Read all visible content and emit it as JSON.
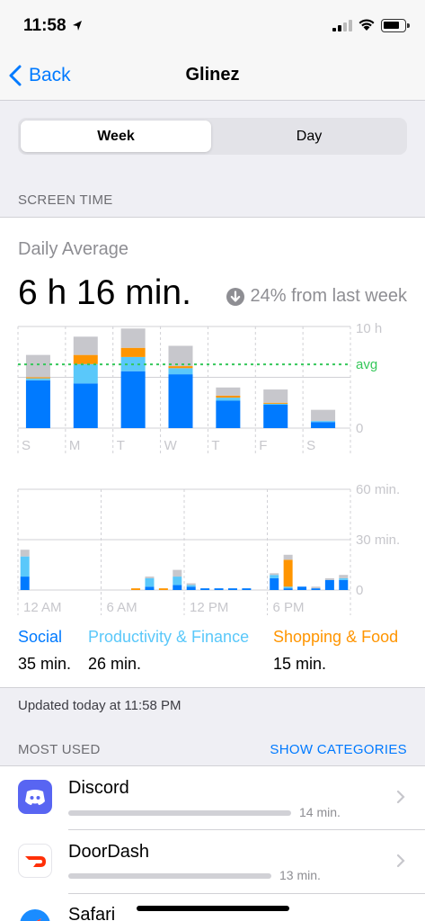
{
  "status": {
    "time": "11:58"
  },
  "nav": {
    "back_label": "Back",
    "title": "Glinez"
  },
  "segments": {
    "week": "Week",
    "day": "Day"
  },
  "section_screen_time": "SCREEN TIME",
  "summary": {
    "label": "Daily Average",
    "value": "6 h 16 min.",
    "delta": "24% from last week"
  },
  "colors": {
    "social": "#007aff",
    "productivity": "#5ac8fa",
    "shopping": "#ff9500",
    "other": "#c7c7cc",
    "average": "#34c759"
  },
  "chart_data": [
    {
      "type": "bar",
      "categories": [
        "S",
        "M",
        "T",
        "W",
        "T",
        "F",
        "S"
      ],
      "y_ticks": [
        "10 h",
        "avg",
        "0"
      ],
      "ylim": [
        0,
        10
      ],
      "average": 6.27,
      "series": [
        {
          "name": "Social",
          "values": [
            4.7,
            4.4,
            5.6,
            5.3,
            2.7,
            2.3,
            0.6
          ]
        },
        {
          "name": "Productivity & Finance",
          "values": [
            0.2,
            1.9,
            1.4,
            0.6,
            0.3,
            0.1,
            0.1
          ]
        },
        {
          "name": "Shopping & Food",
          "values": [
            0.1,
            0.9,
            0.9,
            0.2,
            0.2,
            0.1,
            0.0
          ]
        },
        {
          "values": [
            2.2,
            1.8,
            1.9,
            2.0,
            0.8,
            1.3,
            1.1
          ]
        }
      ]
    },
    {
      "type": "bar",
      "x_ticks": [
        "12 AM",
        "6 AM",
        "12 PM",
        "6 PM"
      ],
      "y_ticks": [
        "60 min.",
        "30 min.",
        "0"
      ],
      "ylim": [
        0,
        60
      ],
      "hours": [
        0,
        1,
        2,
        3,
        4,
        5,
        6,
        7,
        8,
        9,
        10,
        11,
        12,
        13,
        14,
        15,
        16,
        17,
        18,
        19,
        20,
        21,
        22,
        23
      ],
      "series": [
        {
          "name": "Social",
          "values": [
            8,
            0,
            0,
            0,
            0,
            0,
            0,
            0,
            0,
            2,
            0,
            3,
            2,
            1,
            1,
            1,
            1,
            0,
            7,
            1,
            2,
            1,
            6,
            6
          ]
        },
        {
          "name": "Productivity & Finance",
          "values": [
            12,
            0,
            0,
            0,
            0,
            0,
            0,
            0,
            0,
            5,
            0,
            5,
            1,
            0,
            0,
            0,
            0,
            0,
            2,
            1,
            0,
            0,
            0,
            1
          ]
        },
        {
          "name": "Shopping & Food",
          "values": [
            0,
            0,
            0,
            0,
            0,
            0,
            0,
            0,
            1,
            0,
            1,
            0,
            0,
            0,
            0,
            0,
            0,
            0,
            0,
            16,
            0,
            0,
            0,
            0
          ]
        },
        {
          "values": [
            4,
            0,
            0,
            0,
            0,
            0,
            0,
            0,
            0,
            1,
            0,
            4,
            1,
            0,
            0,
            0,
            0,
            0,
            1,
            3,
            0,
            1,
            1,
            2
          ]
        }
      ]
    }
  ],
  "categories_summary": [
    {
      "name": "Social",
      "time": "35 min."
    },
    {
      "name": "Productivity & Finance",
      "time": "26 min."
    },
    {
      "name": "Shopping & Food",
      "time": "15 min."
    }
  ],
  "updated": "Updated today at 11:58 PM",
  "most_used": {
    "header": "MOST USED",
    "action": "SHOW CATEGORIES",
    "apps": [
      {
        "name": "Discord",
        "time": "14 min.",
        "minutes": 14,
        "icon": "discord-icon",
        "color": "#5865f2"
      },
      {
        "name": "DoorDash",
        "time": "13 min.",
        "minutes": 13,
        "icon": "doordash-icon",
        "color": "#ff3008"
      },
      {
        "name": "Safari",
        "icon": "safari-icon",
        "color": "#1a8cff"
      }
    ]
  }
}
